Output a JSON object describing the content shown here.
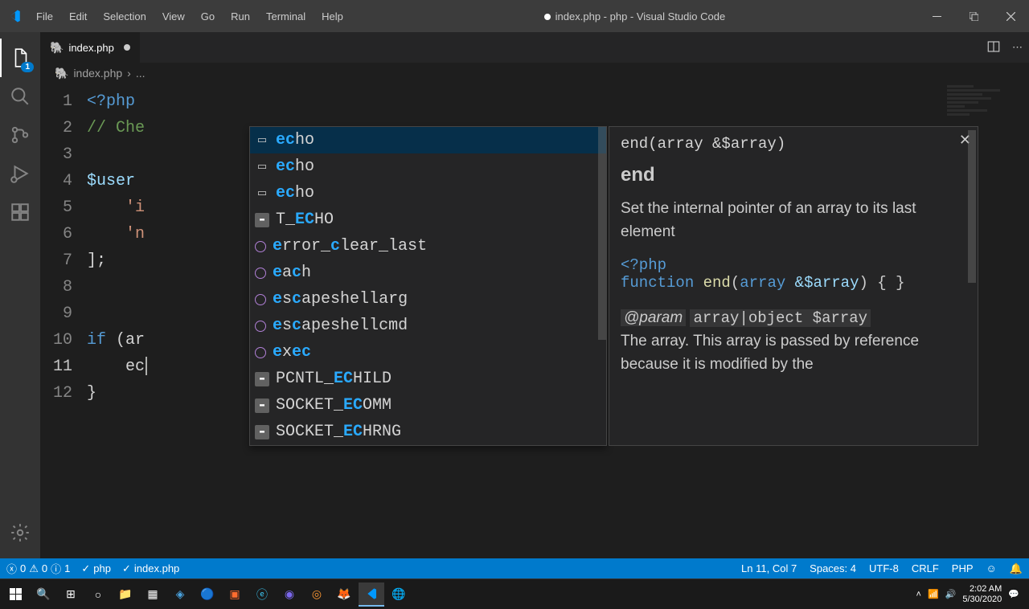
{
  "menu": {
    "file": "File",
    "edit": "Edit",
    "selection": "Selection",
    "view": "View",
    "go": "Go",
    "run": "Run",
    "terminal": "Terminal",
    "help": "Help"
  },
  "title": "index.php - php - Visual Studio Code",
  "sidebar_badge": "1",
  "tab": {
    "name": "index.php"
  },
  "breadcrumb": {
    "file": "index.php",
    "more": "..."
  },
  "lines": [
    "1",
    "2",
    "3",
    "4",
    "5",
    "6",
    "7",
    "8",
    "9",
    "10",
    "11",
    "12"
  ],
  "code": {
    "l1": "<?php",
    "l2": "// Che",
    "l4": "$user",
    "l5": "'i",
    "l6": "'n",
    "l7": "];",
    "l10a": "if",
    "l10b": " (ar",
    "l11": "ec",
    "l12": "}"
  },
  "suggest": [
    {
      "icon": "kw",
      "pre": "ec",
      "rest": "ho"
    },
    {
      "icon": "kw",
      "pre": "ec",
      "rest": "ho"
    },
    {
      "icon": "kw",
      "pre": "ec",
      "rest": "ho"
    },
    {
      "icon": "const",
      "t": "T_",
      "hl": "EC",
      "rest": "HO"
    },
    {
      "icon": "fn",
      "pre": "e",
      "mid": "rror_",
      "hl": "c",
      "rest": "lear_last"
    },
    {
      "icon": "fn",
      "pre": "e",
      "mid": "a",
      "hl": "c",
      "rest": "h"
    },
    {
      "icon": "fn",
      "pre": "e",
      "mid": "s",
      "hl": "c",
      "rest": "apeshellarg"
    },
    {
      "icon": "fn",
      "pre": "e",
      "mid": "s",
      "hl": "c",
      "rest": "apeshellcmd"
    },
    {
      "icon": "fn",
      "pre": "e",
      "mid": "x",
      "hl": "ec",
      "rest": ""
    },
    {
      "icon": "const",
      "t": "PCNTL_",
      "hl": "EC",
      "rest": "HILD"
    },
    {
      "icon": "const",
      "t": "SOCKET_",
      "hl": "EC",
      "rest": "OMM"
    },
    {
      "icon": "const",
      "t": "SOCKET_",
      "hl": "EC",
      "rest": "HRNG"
    }
  ],
  "doc": {
    "sig": "end(array &$array)",
    "name": "end",
    "desc": "Set the internal pointer of an array to its last element",
    "code_open": "<?php",
    "code_fn": "function",
    "code_nm": "end",
    "code_p1": "array",
    "code_p2": "&",
    "code_p3": "$array",
    "code_rest": ") { }",
    "param": "@param",
    "param_t": "array|object $array",
    "param_desc": "The array. This array is passed by reference because it is modified by the"
  },
  "status": {
    "err_x": "0",
    "err_w": "0",
    "err_i": "1",
    "lang1": "php",
    "file": "index.php",
    "pos": "Ln 11, Col 7",
    "spaces": "Spaces: 4",
    "enc": "UTF-8",
    "eol": "CRLF",
    "lang": "PHP"
  },
  "clock": {
    "time": "2:02 AM",
    "date": "5/30/2020"
  }
}
